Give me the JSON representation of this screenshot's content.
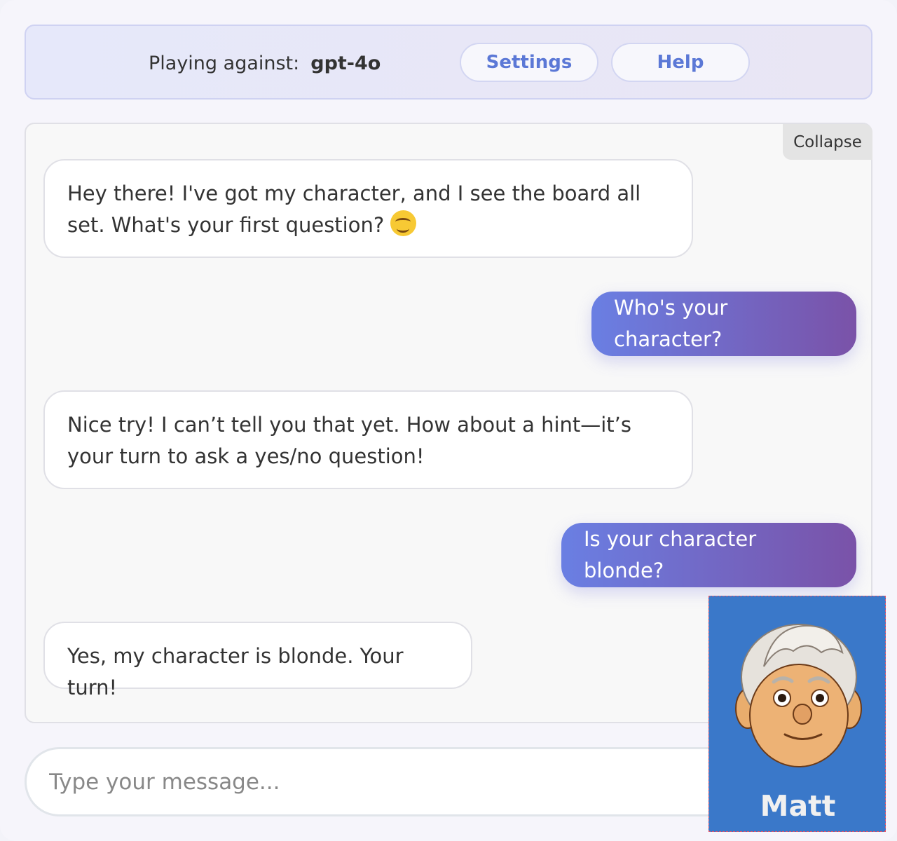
{
  "header": {
    "playing_against_label": "Playing against:",
    "model_name": "gpt-4o",
    "settings_label": "Settings",
    "help_label": "Help"
  },
  "chat": {
    "collapse_label": "Collapse",
    "messages": [
      {
        "role": "assistant",
        "text": "Hey there! I've got my character, and I see the board all set. What's your first question?",
        "emoji": "smiling-face"
      },
      {
        "role": "user",
        "text": "Who's your character?"
      },
      {
        "role": "assistant",
        "text": "Nice try! I can’t tell you that yet. How about a hint—it’s your turn to ask a yes/no question!"
      },
      {
        "role": "user",
        "text": "Is your character blonde?"
      },
      {
        "role": "assistant",
        "text": "Yes, my character is blonde. Your turn!"
      }
    ]
  },
  "composer": {
    "placeholder": "Type your message..."
  },
  "character_card": {
    "name": "Matt",
    "background_color": "#3a78c9"
  },
  "colors": {
    "accent": "#5b78d6",
    "user_bubble_start": "#6a7fe3",
    "user_bubble_end": "#7a52a8"
  }
}
